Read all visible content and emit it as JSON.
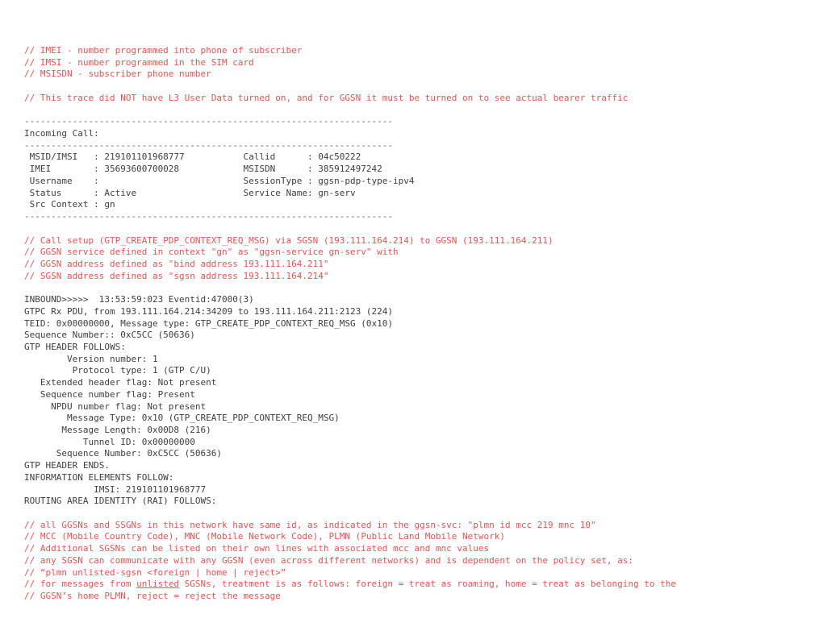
{
  "document": {
    "title": "GTP Trace Log",
    "colors": {
      "comment_red": "#f45050",
      "trace_gray": "#3d3d3d",
      "rule_gray": "#666666",
      "background": "#ffffff"
    }
  },
  "lines": [
    {
      "id": "c1",
      "kind": "comment",
      "text": "// IMEI - number programmed into phone of subscriber"
    },
    {
      "id": "c2",
      "kind": "comment",
      "text": "// IMSI - number programmed in the SIM card"
    },
    {
      "id": "c3",
      "kind": "comment",
      "text": "// MSISDN - subscriber phone number"
    },
    {
      "id": "b1",
      "kind": "blank",
      "text": " "
    },
    {
      "id": "c4",
      "kind": "comment",
      "text": "// This trace did NOT have L3 User Data turned on, and for GGSN it must be turned on to see actual bearer traffic"
    },
    {
      "id": "b2",
      "kind": "blank",
      "text": " "
    },
    {
      "id": "r1",
      "kind": "rule",
      "text": "---------------------------------------------------------------------"
    },
    {
      "id": "t1",
      "kind": "trace",
      "text": "Incoming Call:"
    },
    {
      "id": "r2",
      "kind": "rule",
      "text": "---------------------------------------------------------------------"
    },
    {
      "id": "t2",
      "kind": "trace",
      "text": " MSID/IMSI   : 219101101968777           Callid      : 04c50222"
    },
    {
      "id": "t3",
      "kind": "trace",
      "text": " IMEI        : 35693600700028            MSISDN      : 385912497242"
    },
    {
      "id": "t4",
      "kind": "trace",
      "text": " Username    :                           SessionType : ggsn-pdp-type-ipv4"
    },
    {
      "id": "t5",
      "kind": "trace",
      "text": " Status      : Active                    Service Name: gn-serv"
    },
    {
      "id": "t6",
      "kind": "trace",
      "text": " Src Context : gn"
    },
    {
      "id": "r3",
      "kind": "rule",
      "text": "---------------------------------------------------------------------"
    },
    {
      "id": "b3",
      "kind": "blank",
      "text": " "
    },
    {
      "id": "c5",
      "kind": "comment",
      "text": "// Call setup (GTP_CREATE_PDP_CONTEXT_REQ_MSG) via SGSN (193.111.164.214) to GGSN (193.111.164.211)"
    },
    {
      "id": "c6",
      "kind": "comment",
      "text": "// GGSN service defined in context \"gn\" as \"ggsn-service gn-serv\" with"
    },
    {
      "id": "c7",
      "kind": "comment",
      "text": "// GGSN address defined as \"bind address 193.111.164.211\""
    },
    {
      "id": "c8",
      "kind": "comment",
      "text": "// SGSN address defined as \"sgsn address 193.111.164.214\""
    },
    {
      "id": "b4",
      "kind": "blank",
      "text": " "
    },
    {
      "id": "t7",
      "kind": "trace",
      "text": "INBOUND>>>>>  13:53:59:023 Eventid:47000(3)"
    },
    {
      "id": "t8",
      "kind": "trace",
      "text": "GTPC Rx PDU, from 193.111.164.214:34209 to 193.111.164.211:2123 (224)"
    },
    {
      "id": "t9",
      "kind": "trace",
      "text": "TEID: 0x00000000, Message type: GTP_CREATE_PDP_CONTEXT_REQ_MSG (0x10)"
    },
    {
      "id": "t10",
      "kind": "trace",
      "text": "Sequence Number:: 0xC5CC (50636)"
    },
    {
      "id": "t11",
      "kind": "trace",
      "text": "GTP HEADER FOLLOWS:"
    },
    {
      "id": "t12",
      "kind": "trace",
      "text": "        Version number: 1"
    },
    {
      "id": "t13",
      "kind": "trace",
      "text": "         Protocol type: 1 (GTP C/U)"
    },
    {
      "id": "t14",
      "kind": "trace",
      "text": "   Extended header flag: Not present"
    },
    {
      "id": "t15",
      "kind": "trace",
      "text": "   Sequence number flag: Present"
    },
    {
      "id": "t16",
      "kind": "trace",
      "text": "     NPDU number flag: Not present"
    },
    {
      "id": "t17",
      "kind": "trace",
      "text": "        Message Type: 0x10 (GTP_CREATE_PDP_CONTEXT_REQ_MSG)"
    },
    {
      "id": "t18",
      "kind": "trace",
      "text": "       Message Length: 0x00D8 (216)"
    },
    {
      "id": "t19",
      "kind": "trace",
      "text": "           Tunnel ID: 0x00000000"
    },
    {
      "id": "t20",
      "kind": "trace",
      "text": "      Sequence Number: 0xC5CC (50636)"
    },
    {
      "id": "t21",
      "kind": "trace",
      "text": "GTP HEADER ENDS."
    },
    {
      "id": "t22",
      "kind": "trace",
      "text": "INFORMATION ELEMENTS FOLLOW:"
    },
    {
      "id": "t23",
      "kind": "trace",
      "text": "             IMSI: 219101101968777"
    },
    {
      "id": "t24",
      "kind": "trace",
      "text": "ROUTING AREA IDENTITY (RAI) FOLLOWS:"
    },
    {
      "id": "b5",
      "kind": "blank",
      "text": " "
    },
    {
      "id": "c9",
      "kind": "comment",
      "text": "// all GGSNs and SSGNs in this network have same id, as indicated in the ggsn-svc: \"plmn id mcc 219 mnc 10\""
    },
    {
      "id": "c10",
      "kind": "comment",
      "text": "// MCC (Mobile Country Code), MNC (Mobile Network Code), PLMN (Public Land Mobile Network)"
    },
    {
      "id": "c11",
      "kind": "comment",
      "text": "// Additional SGSNs can be listed on their own lines with associated mcc and mnc values"
    },
    {
      "id": "c12",
      "kind": "comment",
      "text": "// any SGSN can communicate with any GGSN (even across different networks) and is dependent on the policy set, as:"
    },
    {
      "id": "c13",
      "kind": "comment",
      "text": "// “plmn unlisted-sgsn <foreign | home | reject>”"
    },
    {
      "id": "c14",
      "kind": "comment",
      "html": true,
      "segments": [
        {
          "text": "// for messages from "
        },
        {
          "text": "unlisted",
          "underline": true
        },
        {
          "text": " SGSNs, treatment is as follows: foreign = treat as roaming, home = treat as belonging to the"
        }
      ],
      "text": "// for messages from unlisted SGSNs, treatment is as follows: foreign = treat as roaming, home = treat as belonging to the"
    },
    {
      "id": "c15",
      "kind": "comment",
      "text": "// GGSN’s home PLMN, reject = reject the message"
    }
  ]
}
